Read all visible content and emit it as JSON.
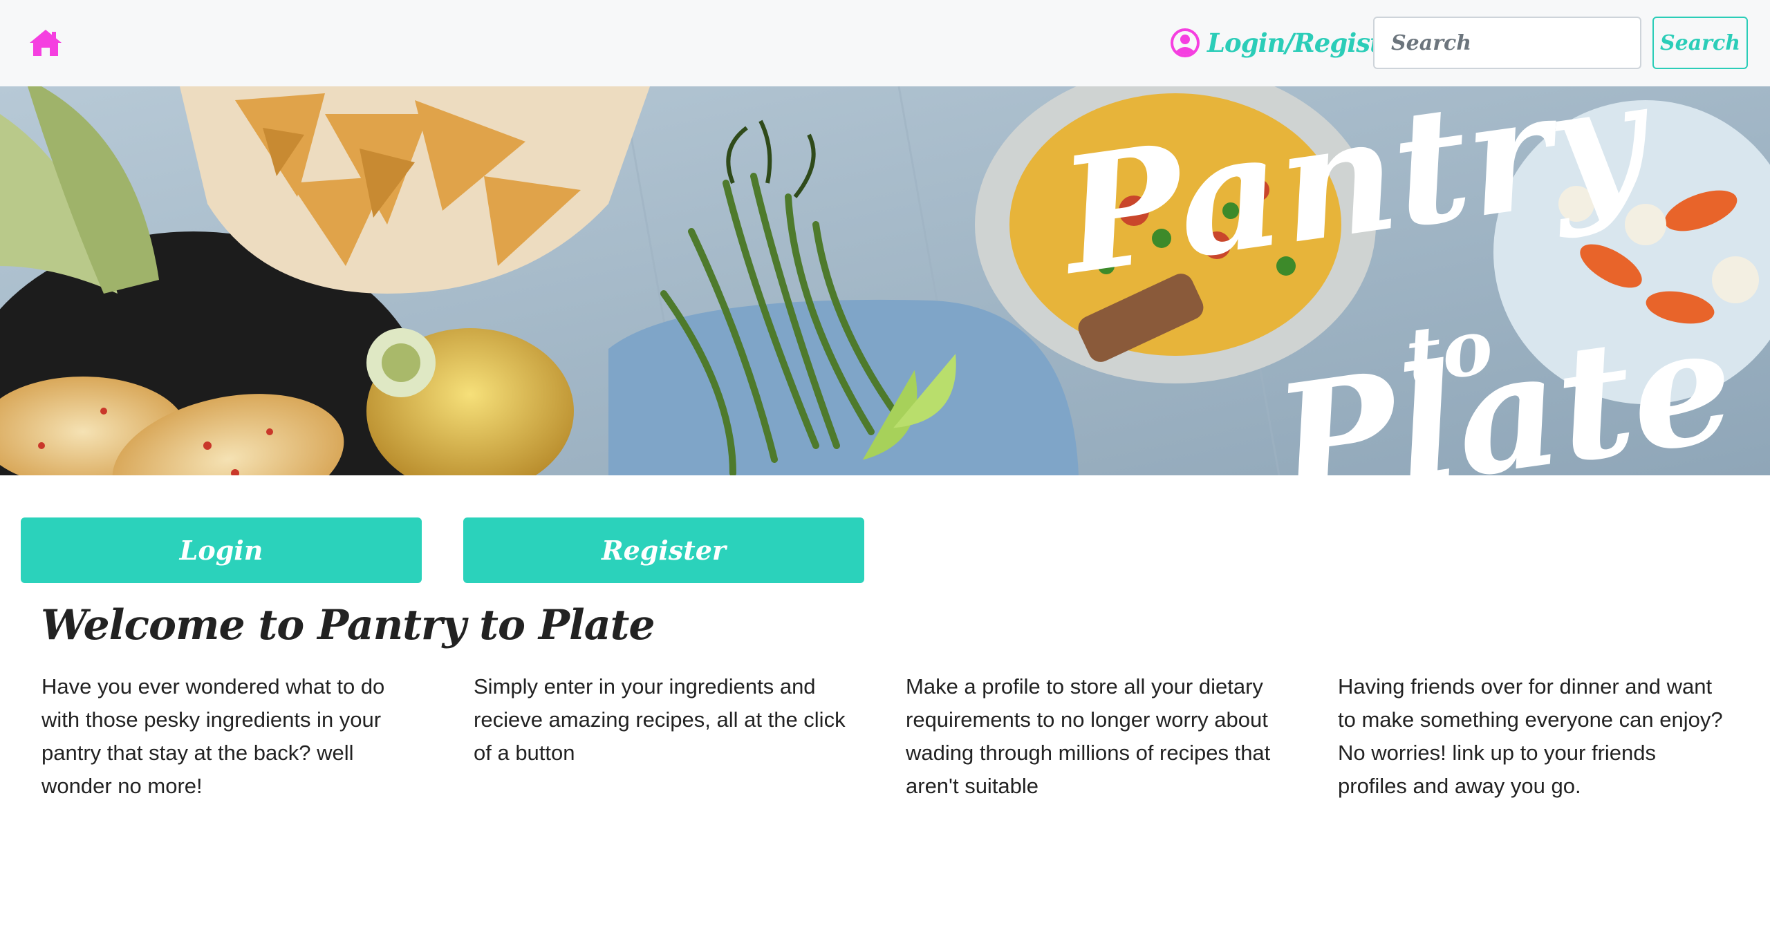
{
  "navbar": {
    "home_icon": "home-icon",
    "login_register_label": "Login/Register",
    "user_icon": "user-circle-icon",
    "search_placeholder": "Search",
    "search_button_label": "Search"
  },
  "hero": {
    "logo_text_line1": "Pantry",
    "logo_text_line2": "to",
    "logo_text_line3": "Plate"
  },
  "actions": {
    "login_label": "Login",
    "register_label": "Register"
  },
  "welcome": {
    "title": "Welcome to Pantry to Plate",
    "features": [
      "Have you ever wondered what to do with those pesky ingredients in your pantry that stay at the back? well wonder no more!",
      "Simply enter in your ingredients and recieve amazing recipes, all at the click of a button",
      "Make a profile to store all your dietary requirements to no longer worry about wading through millions of recipes that aren't suitable",
      "Having friends over for dinner and want to make something everyone can enjoy? No worries! link up to your friends profiles and away you go."
    ]
  },
  "colors": {
    "accent_teal": "#2bcdb8",
    "accent_pink": "#f53fe0",
    "navbar_bg": "#f7f8f9"
  }
}
